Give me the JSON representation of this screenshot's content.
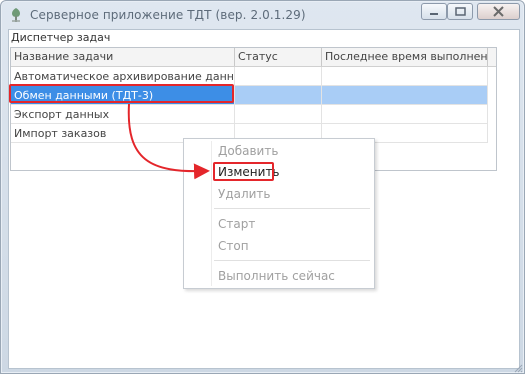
{
  "window": {
    "title": "Серверное приложение ТДТ (вер. 2.0.1.29)",
    "icon": "app-icon"
  },
  "panel": {
    "label": "Диспетчер задач"
  },
  "grid": {
    "columns": [
      "Название задачи",
      "Статус",
      "Последнее время выполнения"
    ],
    "rows": [
      {
        "name": "Автоматическое архивирование данных",
        "status": "",
        "last_run": ""
      },
      {
        "name": "Обмен данными (ТДТ-3)",
        "status": "",
        "last_run": ""
      },
      {
        "name": "Экспорт данных",
        "status": "",
        "last_run": ""
      },
      {
        "name": "Импорт заказов",
        "status": "",
        "last_run": ""
      }
    ],
    "selected_row": 1
  },
  "context_menu": {
    "items": [
      {
        "label": "Добавить",
        "enabled": false
      },
      {
        "label": "Изменить",
        "enabled": true
      },
      {
        "label": "Удалить",
        "enabled": false
      },
      {
        "label": "Старт",
        "enabled": false
      },
      {
        "label": "Стоп",
        "enabled": false
      },
      {
        "label": "Выполнить сейчас",
        "enabled": false
      }
    ]
  },
  "colors": {
    "selection": "#3d8ee6",
    "selection_light": "#a9cdf6",
    "highlight_outline": "#e4262b"
  }
}
